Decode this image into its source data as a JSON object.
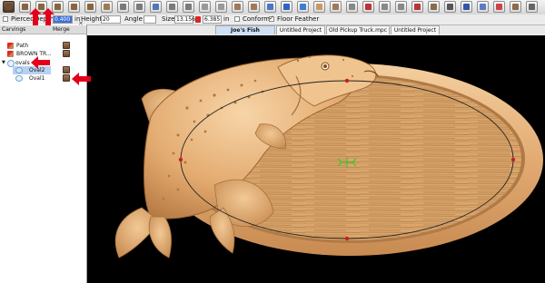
{
  "toolbar": {
    "items": [
      "select-tool",
      "carve-tool",
      "carve-tool",
      "carve-tool",
      "carve-tool",
      "carve-tool",
      "carve-tool",
      "zoom-tool",
      "mirror-tool",
      "transform-tool",
      "sweep-tool",
      "lathe-tool",
      "emboss-tool",
      "tile-tool",
      "relief-tool",
      "smooth-tool",
      "color-tool",
      "sphere-tool",
      "wave-tool",
      "texture-tool",
      "blend-tool",
      "edit-tool",
      "node-tool",
      "star-tool",
      "sharpen-tool",
      "shape-tool",
      "wood-tool",
      "pen-tool",
      "bezier-tool",
      "paint-tool",
      "cut-tool",
      "fish-tool",
      "scissors-tool"
    ]
  },
  "options": {
    "pierced_label": "Pierced",
    "depth_label": "Depth",
    "depth_value": "0.400",
    "depth_unit": "in",
    "height_label": "Height",
    "height_value": "20",
    "angle_label": "Angle",
    "size_label": "Size",
    "size_w": "13.156",
    "size_h": "6.385",
    "size_unit": "in",
    "conform_label": "Conform",
    "floor_feather_label": "Floor Feather"
  },
  "tabs": [
    {
      "label": "Joe's Fish Camp.mpc",
      "active": true
    },
    {
      "label": "Untitled Project",
      "active": false
    },
    {
      "label": "Old Pickup Truck.mpc",
      "active": false
    },
    {
      "label": "Untitled Project",
      "active": false
    }
  ],
  "panel": {
    "carvings_label": "Carvings",
    "merge_label": "Merge",
    "items": [
      {
        "label": "Path",
        "indent": 1,
        "selected": false,
        "icon": "color"
      },
      {
        "label": "BROWN TR...",
        "indent": 1,
        "selected": false,
        "icon": "color"
      },
      {
        "label": "ovals",
        "indent": 0,
        "selected": false,
        "icon": "group"
      },
      {
        "label": "Oval2",
        "indent": 2,
        "selected": true,
        "icon": "shape"
      },
      {
        "label": "Oval1",
        "indent": 2,
        "selected": false,
        "icon": "shape"
      }
    ]
  },
  "colors": {
    "wood_light": "#f0c79a",
    "wood_mid": "#d9a26b",
    "wood_dark": "#a4703f",
    "arrow_red": "#e4001b",
    "handle_red": "#c8201a",
    "selection_green": "#1bd01b"
  }
}
